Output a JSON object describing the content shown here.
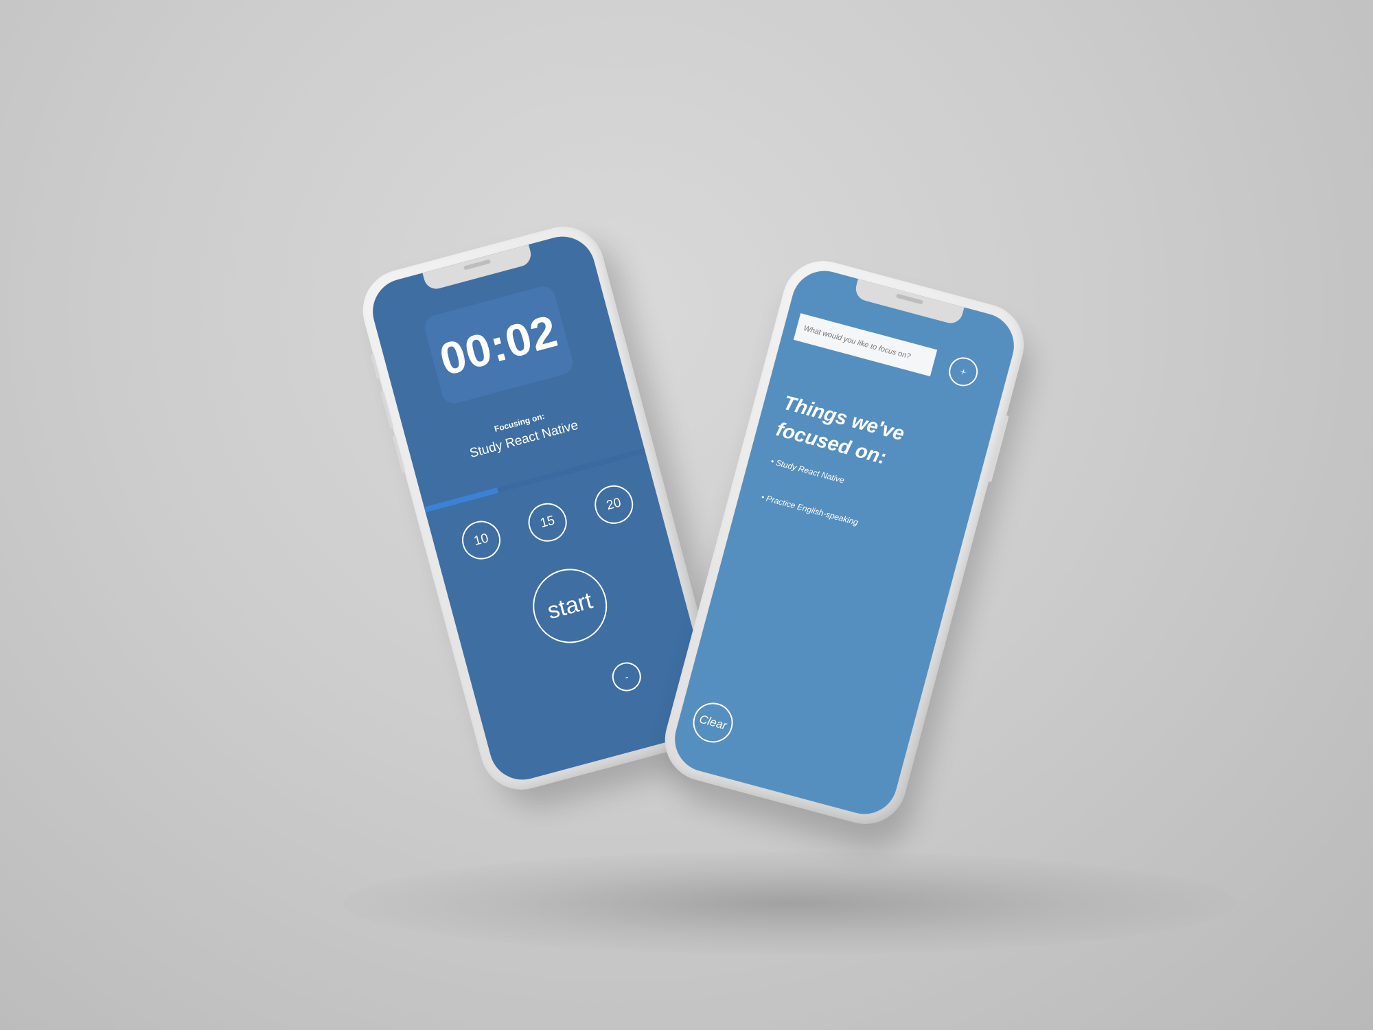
{
  "timer_screen": {
    "timer": "00:02",
    "focusing_label": "Focusing on:",
    "focus_subject": "Study React Native",
    "progress": 0.33,
    "presets": [
      "10",
      "15",
      "20"
    ],
    "start_label": "start",
    "minus_label": "-"
  },
  "history_screen": {
    "input_placeholder": "What would you like to focus on?",
    "add_label": "+",
    "title_line1": "Things we've",
    "title_line2": "focused on:",
    "items": [
      "• Study React Native",
      "• Practice English-speaking"
    ],
    "clear_label": "Clear"
  },
  "colors": {
    "timer_screen_bg": "#3e6ea2",
    "timer_box_bg": "#4676b0",
    "progress_fill": "#3b82d6",
    "history_screen_bg": "#558fbf"
  }
}
